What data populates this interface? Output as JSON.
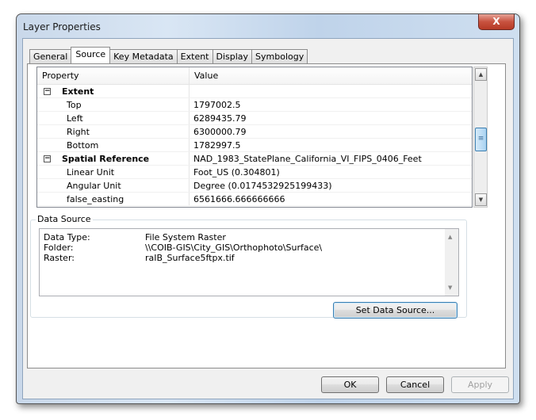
{
  "window": {
    "title": "Layer Properties",
    "close_glyph": "X"
  },
  "tabs": [
    {
      "label": "General",
      "active": false
    },
    {
      "label": "Source",
      "active": true
    },
    {
      "label": "Key Metadata",
      "active": false
    },
    {
      "label": "Extent",
      "active": false
    },
    {
      "label": "Display",
      "active": false
    },
    {
      "label": "Symbology",
      "active": false
    }
  ],
  "grid": {
    "headers": {
      "property": "Property",
      "value": "Value"
    },
    "rows": [
      {
        "property": "Extent",
        "value": "",
        "category": true,
        "expander": "−"
      },
      {
        "property": "Top",
        "value": "1797002.5"
      },
      {
        "property": "Left",
        "value": "6289435.79"
      },
      {
        "property": "Right",
        "value": "6300000.79"
      },
      {
        "property": "Bottom",
        "value": "1782997.5"
      },
      {
        "property": "Spatial Reference",
        "value": "NAD_1983_StatePlane_California_VI_FIPS_0406_Feet",
        "category": true,
        "expander": "−"
      },
      {
        "property": "Linear Unit",
        "value": "Foot_US (0.304801)"
      },
      {
        "property": "Angular Unit",
        "value": "Degree (0.0174532925199433)"
      },
      {
        "property": "false_easting",
        "value": "6561666.666666666"
      }
    ]
  },
  "data_source": {
    "group_label": "Data Source",
    "entries": [
      {
        "key": "Data Type:",
        "value": "File System Raster"
      },
      {
        "key": "Folder:",
        "value": "\\\\COIB-GIS\\City_GIS\\Orthophoto\\Surface\\"
      },
      {
        "key": "Raster:",
        "value": "raIB_Surface5ftpx.tif"
      }
    ],
    "set_button": "Set Data Source..."
  },
  "buttons": {
    "ok": "OK",
    "cancel": "Cancel",
    "apply": "Apply"
  }
}
